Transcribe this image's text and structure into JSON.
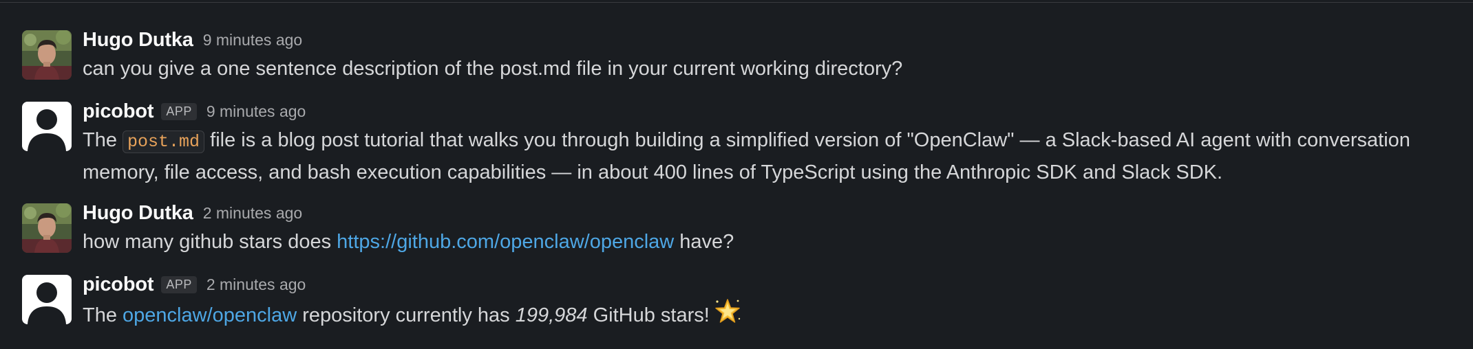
{
  "messages": [
    {
      "sender": "Hugo Dutka",
      "time": "9 minutes ago",
      "text": "can you give a one sentence description of the post.md file in your current working directory?"
    },
    {
      "sender": "picobot",
      "badge": "APP",
      "time": "9 minutes ago",
      "text_before": "The",
      "code": "post.md",
      "text_after": "file is a blog post tutorial that walks you through building a simplified version of \"OpenClaw\" — a Slack-based AI agent with conversation memory, file access, and bash execution capabilities — in about 400 lines of TypeScript using the Anthropic SDK and Slack SDK."
    },
    {
      "sender": "Hugo Dutka",
      "time": "2 minutes ago",
      "text_before": "how many github stars does",
      "link": "https://github.com/openclaw/openclaw",
      "text_after": "have?"
    },
    {
      "sender": "picobot",
      "badge": "APP",
      "time": "2 minutes ago",
      "text_before": "The",
      "link": "openclaw/openclaw",
      "text_middle": "repository currently has",
      "number": "199,984",
      "text_after": "GitHub stars!",
      "emoji": "glowing-star-icon"
    }
  ],
  "colors": {
    "background": "#1a1d21",
    "link": "#4ea7e5",
    "code": "#e7a25a",
    "sender": "#f8f8f8",
    "text": "#d6d7d9"
  }
}
